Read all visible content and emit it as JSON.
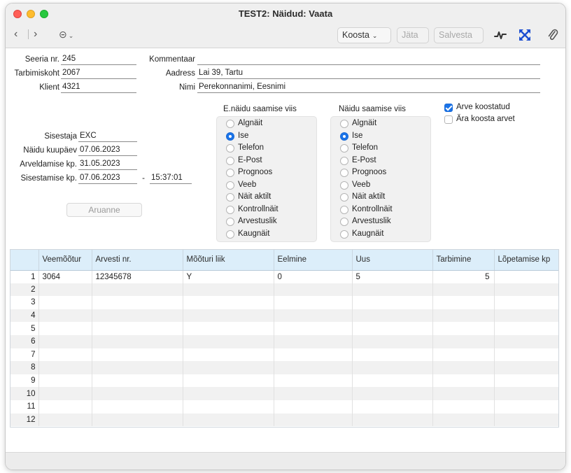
{
  "window": {
    "title": "TEST2: Näidud: Vaata"
  },
  "toolbar": {
    "koosta_label": "Koosta",
    "jata_label": "Jäta",
    "salvesta_label": "Salvesta"
  },
  "header": {
    "seeria_label": "Seeria nr.",
    "seeria_value": "245",
    "tarbimiskoht_label": "Tarbimiskoht",
    "tarbimiskoht_value": "2067",
    "klient_label": "Klient",
    "klient_value": "4321",
    "kommentaar_label": "Kommentaar",
    "kommentaar_value": "",
    "aadress_label": "Aadress",
    "aadress_value": "Lai 39, Tartu",
    "nimi_label": "Nimi",
    "nimi_value": "Perekonnanimi, Eesnimi"
  },
  "left_fields": {
    "sisestaja_label": "Sisestaja",
    "sisestaja_value": "EXC",
    "naidu_kuupaev_label": "Näidu kuupäev",
    "naidu_kuupaev_value": "07.06.2023",
    "arveldamise_label": "Arveldamise kp.",
    "arveldamise_value": "31.05.2023",
    "sisestamise_label": "Sisestamise kp.",
    "sisestamise_value": "07.06.2023",
    "dash": "-",
    "time_value": "15:37:01",
    "aruanne_label": "Aruanne"
  },
  "e_naidu_group": {
    "title": "E.näidu saamise viis",
    "options": [
      {
        "label": "Algnäit",
        "selected": false
      },
      {
        "label": "Ise",
        "selected": true
      },
      {
        "label": "Telefon",
        "selected": false
      },
      {
        "label": "E-Post",
        "selected": false
      },
      {
        "label": "Prognoos",
        "selected": false
      },
      {
        "label": "Veeb",
        "selected": false
      },
      {
        "label": "Näit aktilt",
        "selected": false
      },
      {
        "label": "Kontrollnäit",
        "selected": false
      },
      {
        "label": "Arvestuslik",
        "selected": false
      },
      {
        "label": "Kaugnäit",
        "selected": false
      }
    ]
  },
  "naidu_group": {
    "title": "Näidu saamise viis",
    "options": [
      {
        "label": "Algnäit",
        "selected": false
      },
      {
        "label": "Ise",
        "selected": true
      },
      {
        "label": "Telefon",
        "selected": false
      },
      {
        "label": "E-Post",
        "selected": false
      },
      {
        "label": "Prognoos",
        "selected": false
      },
      {
        "label": "Veeb",
        "selected": false
      },
      {
        "label": "Näit aktilt",
        "selected": false
      },
      {
        "label": "Kontrollnäit",
        "selected": false
      },
      {
        "label": "Arvestuslik",
        "selected": false
      },
      {
        "label": "Kaugnäit",
        "selected": false
      }
    ]
  },
  "checkboxes": {
    "arve_koostatud_label": "Arve koostatud",
    "arve_koostatud_checked": true,
    "ara_koosta_label": "Ära koosta arvet",
    "ara_koosta_checked": false
  },
  "table": {
    "columns": [
      "",
      "Veemõõtur",
      "Arvesti nr.",
      "Mõõturi liik",
      "Eelmine",
      "Uus",
      "Tarbimine",
      "Lõpetamise kp"
    ],
    "rows": [
      [
        "1",
        "3064",
        "12345678",
        "Y",
        "0",
        "5",
        "5",
        ""
      ],
      [
        "2",
        "",
        "",
        "",
        "",
        "",
        "",
        ""
      ],
      [
        "3",
        "",
        "",
        "",
        "",
        "",
        "",
        ""
      ],
      [
        "4",
        "",
        "",
        "",
        "",
        "",
        "",
        ""
      ],
      [
        "5",
        "",
        "",
        "",
        "",
        "",
        "",
        ""
      ],
      [
        "6",
        "",
        "",
        "",
        "",
        "",
        "",
        ""
      ],
      [
        "7",
        "",
        "",
        "",
        "",
        "",
        "",
        ""
      ],
      [
        "8",
        "",
        "",
        "",
        "",
        "",
        "",
        ""
      ],
      [
        "9",
        "",
        "",
        "",
        "",
        "",
        "",
        ""
      ],
      [
        "10",
        "",
        "",
        "",
        "",
        "",
        "",
        ""
      ],
      [
        "11",
        "",
        "",
        "",
        "",
        "",
        "",
        ""
      ],
      [
        "12",
        "",
        "",
        "",
        "",
        "",
        "",
        ""
      ]
    ]
  },
  "colors": {
    "accent": "#1a73e8",
    "header_bg": "#dceefa",
    "stripe": "#f1f1f1"
  }
}
